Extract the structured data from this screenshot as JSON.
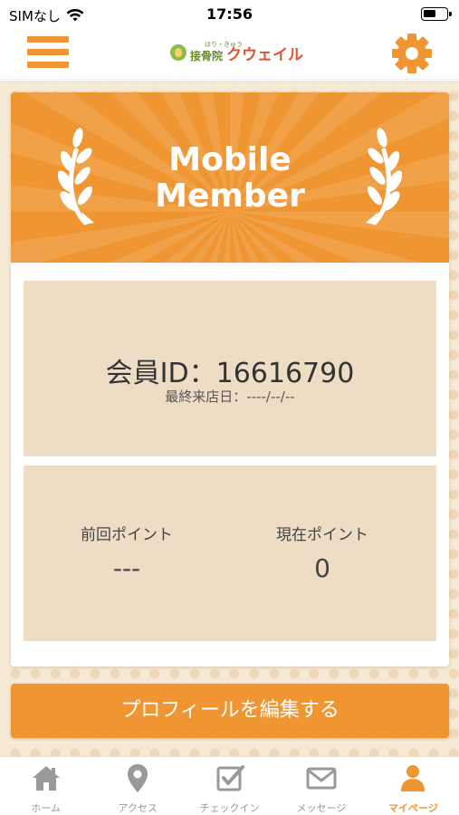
{
  "status_bar": {
    "carrier": "SIMなし",
    "time": "17:56"
  },
  "header": {
    "logo_small": "はり・きゅう",
    "logo_sub": "接骨院",
    "logo_name": "クウェイル"
  },
  "card": {
    "title_line1": "Mobile",
    "title_line2": "Member",
    "member_id": "会員ID：16616790",
    "last_visit": "最終来店日：----/--/--",
    "points": {
      "previous_label": "前回ポイント",
      "previous_value": "---",
      "current_label": "現在ポイント",
      "current_value": "0"
    }
  },
  "profile_button": "プロフィールを編集する",
  "tabs": [
    {
      "label": "ホーム",
      "icon": "home-icon",
      "active": false
    },
    {
      "label": "アクセス",
      "icon": "map-pin-icon",
      "active": false
    },
    {
      "label": "チェックイン",
      "icon": "checkin-icon",
      "active": false
    },
    {
      "label": "メッセージ",
      "icon": "envelope-icon",
      "active": false
    },
    {
      "label": "マイページ",
      "icon": "person-icon",
      "active": true
    }
  ],
  "colors": {
    "accent": "#ef9633",
    "panel": "#efdcc4",
    "background": "#f6ead7",
    "logo_red": "#e4512e",
    "logo_green": "#6a8a2c",
    "tab_inactive": "#999999"
  }
}
